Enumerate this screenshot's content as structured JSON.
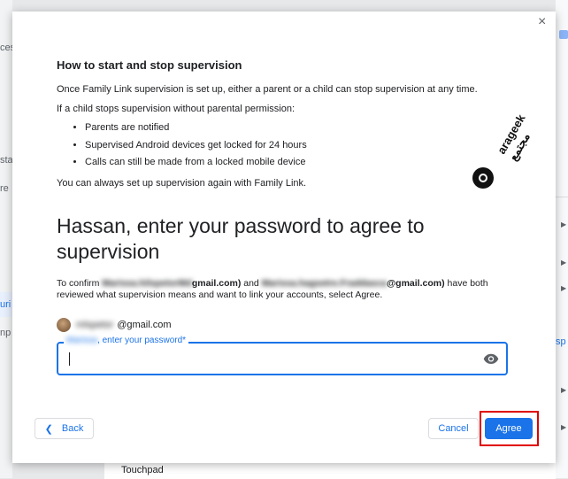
{
  "background": {
    "left_items": [
      "ces",
      "sta",
      "re",
      "uri",
      "np"
    ],
    "right_link": "sp",
    "bottom_item": "Touchpad"
  },
  "dialog": {
    "close_label": "×",
    "section_heading": "How to start and stop supervision",
    "paragraph_1": "Once Family Link supervision is set up, either a parent or a child can stop supervision at any time.",
    "paragraph_2": "If a child stops supervision without parental permission:",
    "bullets": [
      "Parents are notified",
      "Supervised Android devices get locked for 24 hours",
      "Calls can still be made from a locked mobile device"
    ],
    "paragraph_3": "You can always set up supervision again with Family Link.",
    "watermark": "arageek مجتمع",
    "title_name": "Hassan",
    "title_rest": ", enter your password to agree to supervision",
    "confirm": {
      "prefix": "To confirm ",
      "parent_email_hidden": "Marissa.hilspetorMd",
      "parent_email_domain": "gmail.com)",
      "and": " and ",
      "child_email_hidden": "Marissa.hagsetre.Fraddasca",
      "child_email_domain": "@gmail.com)",
      "suffix": " have both reviewed what supervision means and want to link your accounts, select Agree."
    },
    "account_hidden": "mlspetor",
    "account_domain": "@gmail.com",
    "password_label_hidden": "Marissa",
    "password_label": ", enter your password*",
    "password_value": "",
    "back_label": "Back",
    "cancel_label": "Cancel",
    "agree_label": "Agree"
  },
  "colors": {
    "accent": "#1a73e8",
    "highlight": "#e00000"
  }
}
